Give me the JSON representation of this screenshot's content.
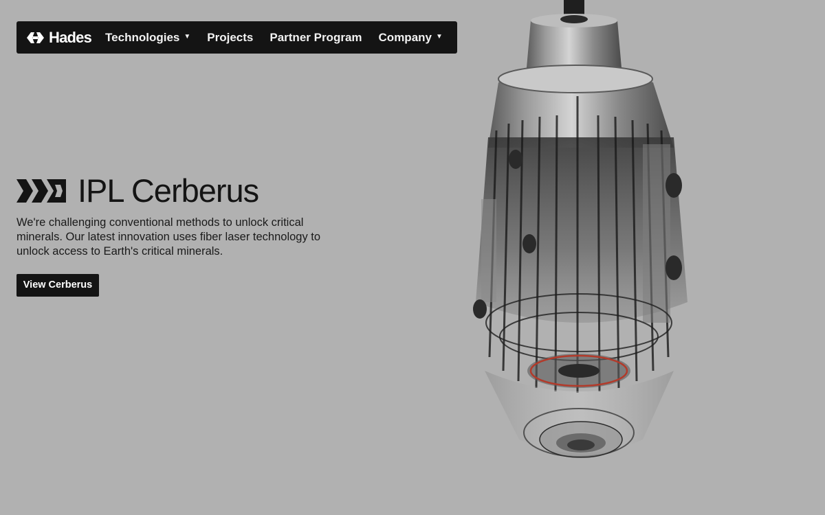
{
  "nav": {
    "brand": "Hades",
    "items": [
      {
        "label": "Technologies",
        "caret": "▼"
      },
      {
        "label": "Projects",
        "caret": ""
      },
      {
        "label": "Partner Program",
        "caret": ""
      },
      {
        "label": "Company",
        "caret": "▼"
      }
    ]
  },
  "hero": {
    "title": "IPL Cerberus",
    "description": "We're challenging conventional methods to unlock critical minerals. Our latest innovation uses fiber laser technology to unlock access to Earth's critical minerals.",
    "cta_label": "View Cerberus"
  },
  "icons": {
    "brand_logo": "hades-logo-icon",
    "product_mark": "cerberus-mark-icon",
    "caret": "caret-down-icon"
  },
  "colors": {
    "background": "#b1b1b1",
    "nav_bg": "#141414",
    "text": "#141414",
    "nav_text": "#f2f2f2"
  }
}
